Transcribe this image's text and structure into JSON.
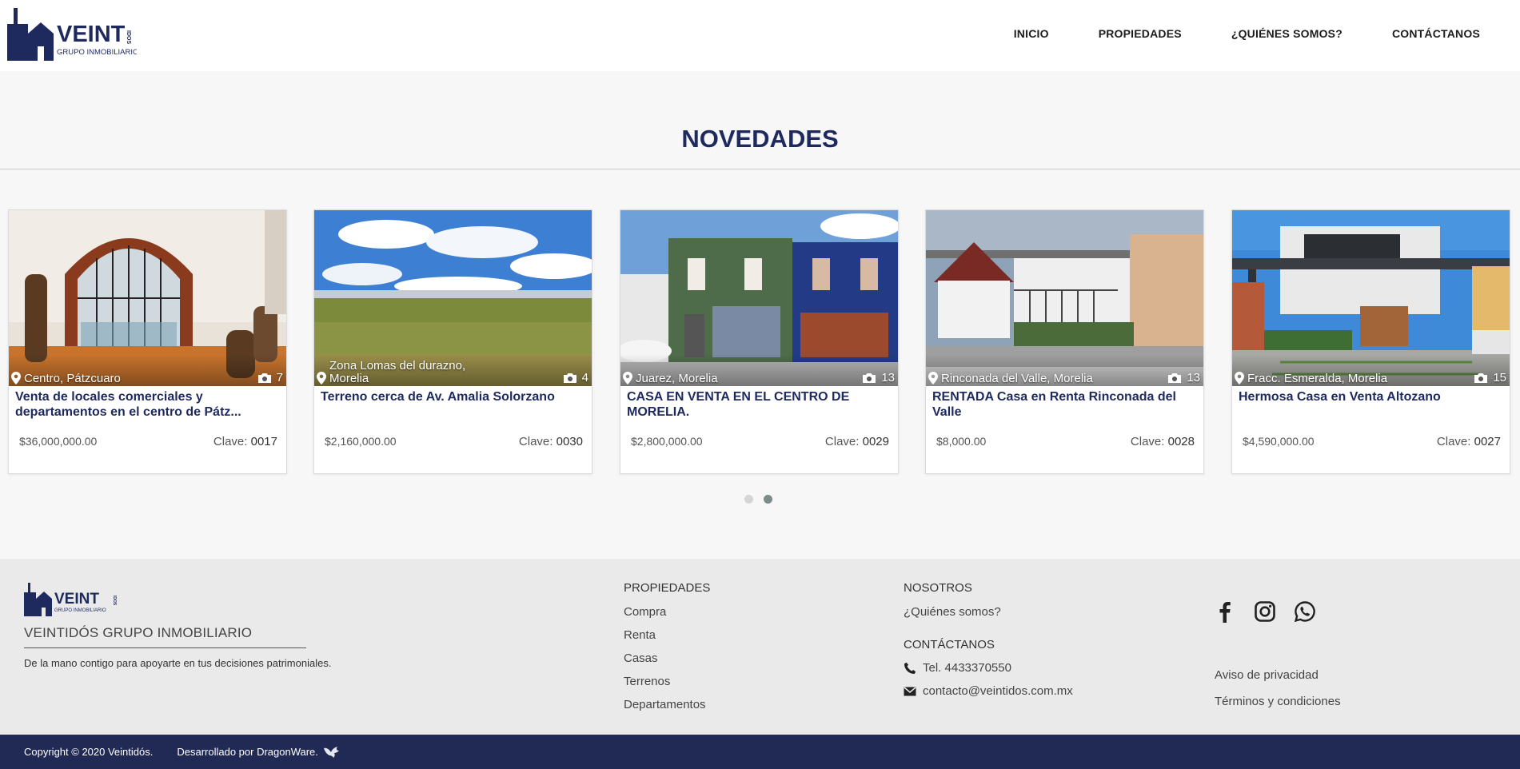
{
  "brand": {
    "logo_text": "VEINTIDOS",
    "logo_sub": "GRUPO INMOBILIARIO",
    "primary_color": "#1e2a5e"
  },
  "nav": [
    {
      "label": "INICIO"
    },
    {
      "label": "PROPIEDADES"
    },
    {
      "label": "¿QUIÉNES SOMOS?"
    },
    {
      "label": "CONTÁCTANOS"
    }
  ],
  "section": {
    "title": "NOVEDADES"
  },
  "cards": [
    {
      "location": "Centro, Pátzcuaro",
      "photos": "7",
      "title": "Venta de locales comerciales y departamentos en el centro de Pátz...",
      "price": "$36,000,000.00",
      "clave_label": "Clave:",
      "clave": "0017",
      "scene": "interior-arch"
    },
    {
      "location": "Zona Lomas del durazno, Morelia",
      "photos": "4",
      "title": "Terreno cerca de Av. Amalia Solorzano",
      "price": "$2,160,000.00",
      "clave_label": "Clave:",
      "clave": "0030",
      "scene": "field"
    },
    {
      "location": "Juarez, Morelia",
      "photos": "13",
      "title": "CASA EN VENTA EN EL CENTRO DE MORELIA.",
      "price": "$2,800,000.00",
      "clave_label": "Clave:",
      "clave": "0029",
      "scene": "street-facades"
    },
    {
      "location": "Rinconada del Valle, Morelia",
      "photos": "13",
      "title": "RENTADA Casa en Renta Rinconada del Valle",
      "price": "$8,000.00",
      "clave_label": "Clave:",
      "clave": "0028",
      "scene": "white-house"
    },
    {
      "location": "Fracc. Esmeralda, Morelia",
      "photos": "15",
      "title": "Hermosa Casa en Venta Altozano",
      "price": "$4,590,000.00",
      "clave_label": "Clave:",
      "clave": "0027",
      "scene": "modern-house"
    }
  ],
  "carousel": {
    "pages": 2,
    "active_page": 2
  },
  "footer": {
    "brand_name": "VEINTIDÓS GRUPO INMOBILIARIO",
    "slogan": "De la mano contigo para apoyarte en tus decisiones patrimoniales.",
    "col_properties": {
      "heading": "PROPIEDADES",
      "links": [
        "Compra",
        "Renta",
        "Casas",
        "Terrenos",
        "Departamentos"
      ]
    },
    "col_about": {
      "heading": "NOSOTROS",
      "links": [
        "¿Quiénes somos?"
      ],
      "contact_heading": "CONTÁCTANOS",
      "phone": "Tel. 4433370550",
      "email": "contacto@veintidos.com.mx"
    },
    "social_icons": [
      "facebook-icon",
      "instagram-icon",
      "whatsapp-icon"
    ],
    "legal_links": [
      "Aviso de privacidad",
      "Términos y condiciones"
    ]
  },
  "bottombar": {
    "copyright": "Copyright © 2020 Veintidós.",
    "developer": "Desarrollado por DragonWare.",
    "background": "#212a55"
  }
}
